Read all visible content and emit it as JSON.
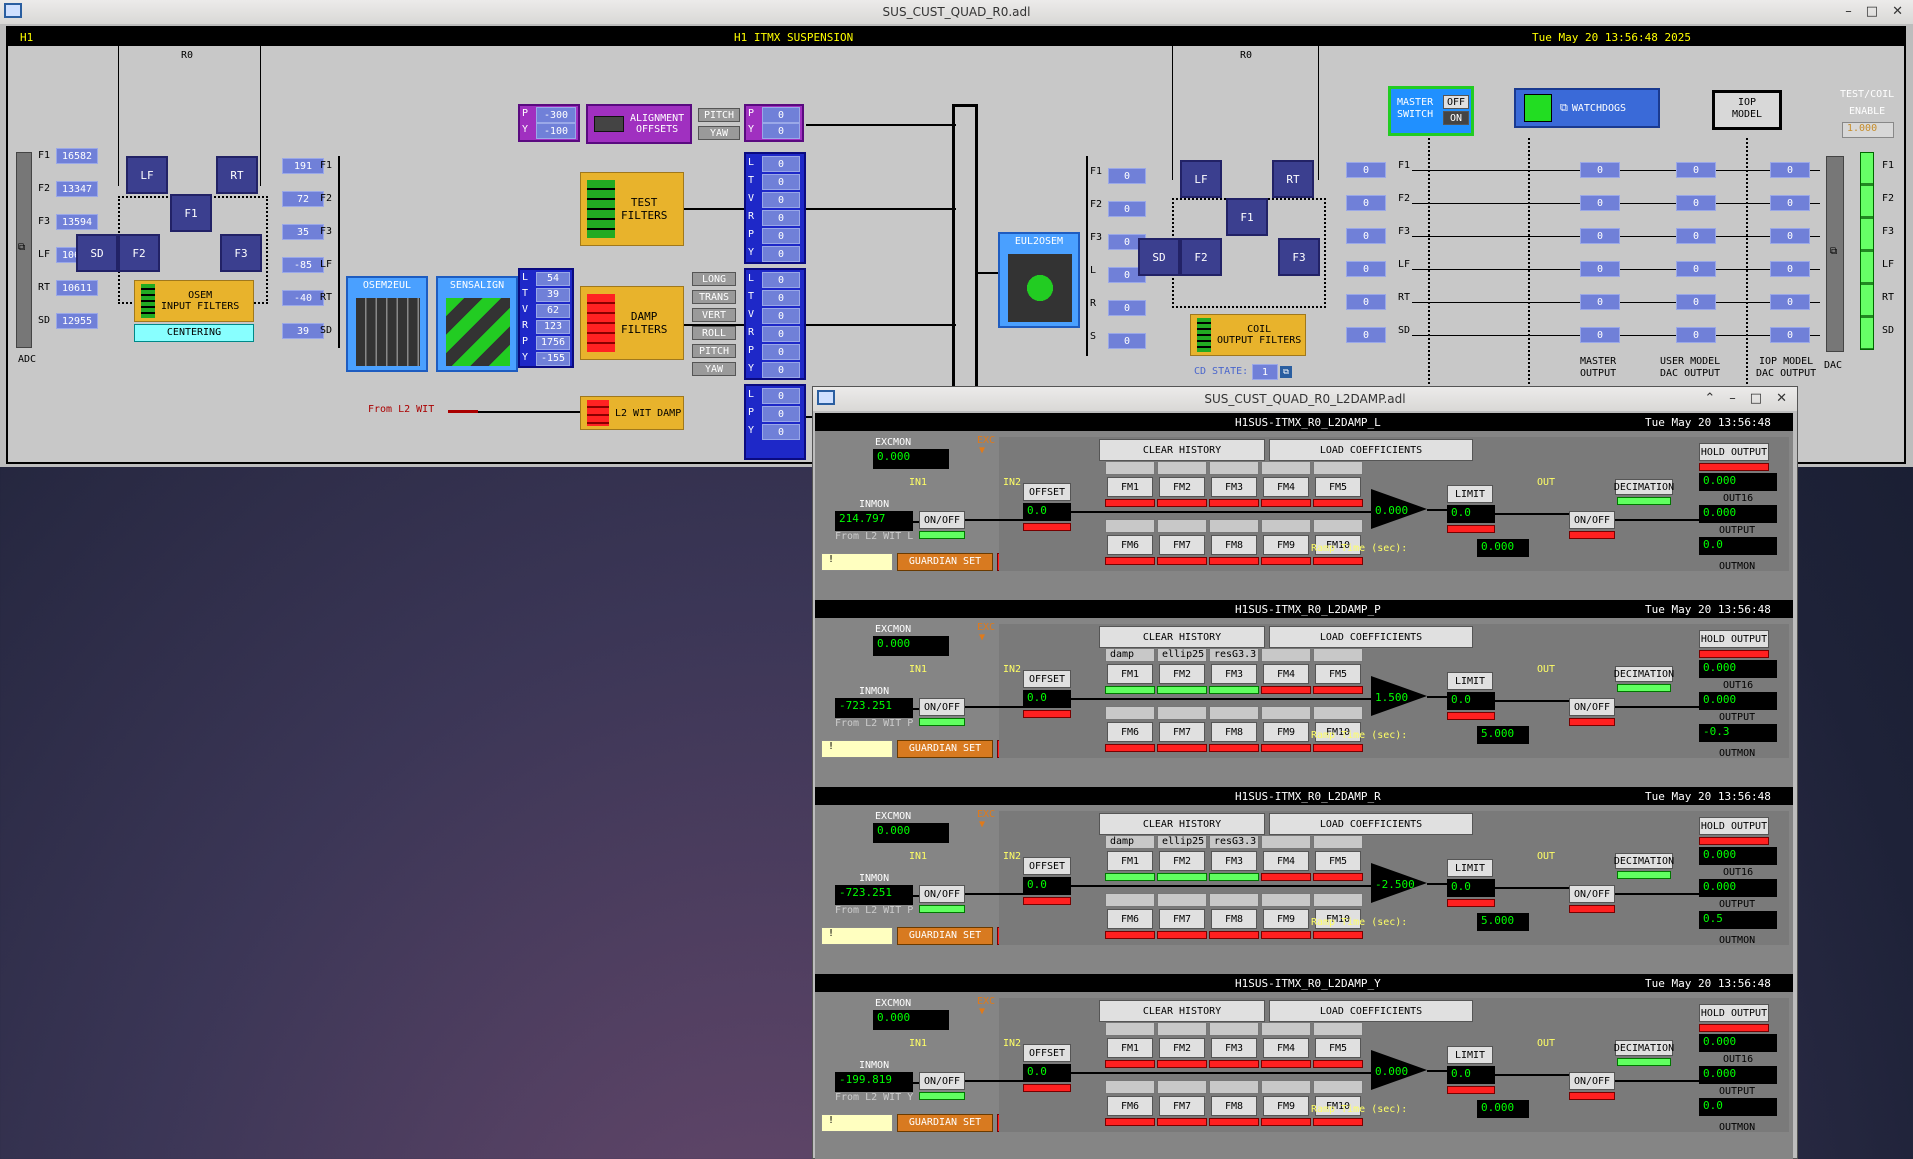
{
  "main_window": {
    "title": "SUS_CUST_QUAD_R0.adl",
    "header_left": "H1",
    "header_center": "H1 ITMX SUSPENSION",
    "header_right": "Tue May 20 13:56:48 2025",
    "r0_left": "R0",
    "r0_right": "R0",
    "adc_label": "ADC",
    "dac_label": "DAC",
    "adc_rows": [
      {
        "ch": "F1",
        "val": "16582"
      },
      {
        "ch": "F2",
        "val": "13347"
      },
      {
        "ch": "F3",
        "val": "13594"
      },
      {
        "ch": "LF",
        "val": "10606"
      },
      {
        "ch": "RT",
        "val": "10611"
      },
      {
        "ch": "SD",
        "val": "12955"
      }
    ],
    "osem_rows": [
      {
        "ch": "F1",
        "val": "191"
      },
      {
        "ch": "F2",
        "val": "72"
      },
      {
        "ch": "F3",
        "val": "35"
      },
      {
        "ch": "LF",
        "val": "-85"
      },
      {
        "ch": "RT",
        "val": "-40"
      },
      {
        "ch": "SD",
        "val": "39"
      }
    ],
    "osem_input_filters": "OSEM\nINPUT FILTERS",
    "centering": "CENTERING",
    "osem2eul": "OSEM2EUL",
    "sensalign": "SENSALIGN",
    "dof_vals": [
      {
        "ch": "L",
        "val": "54"
      },
      {
        "ch": "T",
        "val": "39"
      },
      {
        "ch": "V",
        "val": "62"
      },
      {
        "ch": "R",
        "val": "123"
      },
      {
        "ch": "P",
        "val": "1756"
      },
      {
        "ch": "Y",
        "val": "-155"
      }
    ],
    "alignment_offsets": "ALIGNMENT\nOFFSETS",
    "align_p": "-300",
    "align_y": "-100",
    "pitch": "PITCH",
    "yaw": "YAW",
    "py_out_p": "0",
    "py_out_y": "0",
    "test_filters": "TEST\nFILTERS",
    "damp_filters": "DAMP\nFILTERS",
    "l2_wit_damp": "L2 WIT DAMP",
    "from_l2_wit": "From L2 WIT",
    "damp_dof_labels": [
      "LONG",
      "TRANS",
      "VERT",
      "ROLL",
      "PITCH",
      "YAW"
    ],
    "ltv_labels": [
      "L",
      "T",
      "V",
      "R",
      "P",
      "Y"
    ],
    "lpy_labels": [
      "L",
      "P",
      "Y"
    ],
    "zero": "0",
    "eul2osem": "EUL2OSEM",
    "coil_output_filters": "COIL\nOUTPUT FILTERS",
    "cd_state_label": "CD STATE:",
    "cd_state": "1",
    "coil_rows": [
      "F1",
      "F2",
      "F3",
      "L",
      "R",
      "S"
    ],
    "master_switch": "MASTER\nSWITCH",
    "off": "OFF",
    "on": "ON",
    "watchdogs": "WATCHDOGS",
    "iop_model": "IOP\nMODEL",
    "test_coil_enable": "TEST/COIL\nENABLE",
    "test_coil_value": "1.000",
    "out_rows": [
      "F1",
      "F2",
      "F3",
      "LF",
      "RT",
      "SD"
    ],
    "master_output": "MASTER\nOUTPUT",
    "user_model_dac_output": "USER MODEL\nDAC OUTPUT",
    "iop_model_dac_output": "IOP MODEL\nDAC OUTPUT",
    "btn_lf": "LF",
    "btn_rt": "RT",
    "btn_f1": "F1",
    "btn_f2": "F2",
    "btn_f3": "F3",
    "btn_sd": "SD"
  },
  "damp_window": {
    "title": "SUS_CUST_QUAD_R0_L2DAMP.adl",
    "panels": [
      {
        "name": "H1SUS-ITMX_R0_L2DAMP_L",
        "time": "Tue May 20 13:56:48",
        "excmon": "0.000",
        "inmon": "214.797",
        "from": "From L2 WIT L",
        "gain": "0.000",
        "offset": "0.0",
        "limit": "0.0",
        "ramp": "0.000",
        "hold": "0.000",
        "out16": "0.000",
        "output": "0.0",
        "fm_names": [
          "",
          "",
          "",
          "",
          "",
          "",
          "",
          "",
          "",
          ""
        ],
        "fm_on": [
          false,
          false,
          false,
          false,
          false,
          false,
          false,
          false,
          false,
          false
        ]
      },
      {
        "name": "H1SUS-ITMX_R0_L2DAMP_P",
        "time": "Tue May 20 13:56:48",
        "excmon": "0.000",
        "inmon": "-723.251",
        "from": "From L2 WIT P",
        "gain": "1.500",
        "offset": "0.0",
        "limit": "0.0",
        "ramp": "5.000",
        "hold": "0.000",
        "out16": "0.000",
        "output": "-0.3",
        "fm_names": [
          "damp",
          "ellip25",
          "resG3.3",
          "",
          "",
          "",
          "",
          "",
          "",
          ""
        ],
        "fm_on": [
          true,
          true,
          true,
          false,
          false,
          false,
          false,
          false,
          false,
          false
        ]
      },
      {
        "name": "H1SUS-ITMX_R0_L2DAMP_R",
        "time": "Tue May 20 13:56:48",
        "excmon": "0.000",
        "inmon": "-723.251",
        "from": "From L2 WIT P",
        "gain": "-2.500",
        "offset": "0.0",
        "limit": "0.0",
        "ramp": "5.000",
        "hold": "0.000",
        "out16": "0.000",
        "output": "0.5",
        "fm_names": [
          "damp",
          "ellip25",
          "resG3.3",
          "",
          "",
          "",
          "",
          "",
          "",
          ""
        ],
        "fm_on": [
          true,
          true,
          true,
          false,
          false,
          false,
          false,
          false,
          false,
          false
        ]
      },
      {
        "name": "H1SUS-ITMX_R0_L2DAMP_Y",
        "time": "Tue May 20 13:56:48",
        "excmon": "0.000",
        "inmon": "-199.819",
        "from": "From L2 WIT Y",
        "gain": "0.000",
        "offset": "0.0",
        "limit": "0.0",
        "ramp": "0.000",
        "hold": "0.000",
        "out16": "0.000",
        "output": "0.0",
        "fm_names": [
          "",
          "",
          "",
          "",
          "",
          "",
          "",
          "",
          "",
          ""
        ],
        "fm_on": [
          false,
          false,
          false,
          false,
          false,
          false,
          false,
          false,
          false,
          false
        ]
      }
    ],
    "labels": {
      "excmon": "EXCMON",
      "exc": "EXC",
      "inmon": "INMON",
      "in1": "IN1",
      "in2": "IN2",
      "onoff": "ON/OFF",
      "offset": "OFFSET",
      "clear_history": "CLEAR HISTORY",
      "load_coefficients": "LOAD COEFFICIENTS",
      "limit": "LIMIT",
      "out": "OUT",
      "decimation": "DECIMATION",
      "hold_output": "HOLD OUTPUT",
      "out16": "OUT16",
      "output": "OUTPUT",
      "outmon": "OUTMON",
      "ramp_time": "Ramp Time (sec):",
      "guardian_set": "GUARDIAN SET",
      "bang": "!",
      "fm": [
        "FM1",
        "FM2",
        "FM3",
        "FM4",
        "FM5",
        "FM6",
        "FM7",
        "FM8",
        "FM9",
        "FM10"
      ]
    }
  }
}
